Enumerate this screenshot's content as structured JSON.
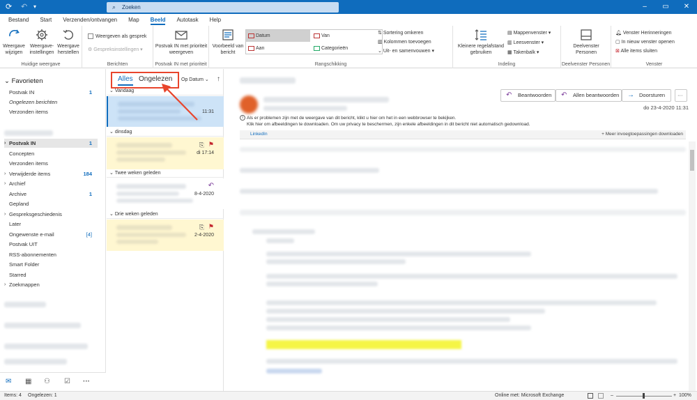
{
  "titlebar": {
    "search_placeholder": "Zoeken"
  },
  "menu": {
    "tabs": [
      "Bestand",
      "Start",
      "Verzenden/ontvangen",
      "Map",
      "Beeld",
      "Autotask",
      "Help"
    ],
    "active": "Beeld"
  },
  "ribbon": {
    "huidige_weergave": {
      "label": "Huidige weergave",
      "wijzigen": "Weergave wijzigen",
      "instellingen": "Weergave-instellingen",
      "herstellen": "Weergave herstellen"
    },
    "berichten": {
      "label": "Berichten",
      "als_gesprek": "Weergeven als gesprek",
      "gespreksinstellingen": "Gespreksinstellingen"
    },
    "prioriteit": {
      "label": "Postvak IN met prioriteit",
      "button": "Postvak IN met prioriteit weergeven"
    },
    "rangschikking": {
      "label": "Rangschikking",
      "voorbeeld": "Voorbeeld van bericht",
      "datum": "Datum",
      "van": "Van",
      "aan": "Aan",
      "categorieen": "Categorieën",
      "sortering": "Sortering omkeren",
      "kolommen": "Kolommen toevoegen",
      "uitvouwen": "Uit- en samenvouwen"
    },
    "indeling": {
      "label": "Indeling",
      "regelafstand": "Kleinere regelafstand gebruiken",
      "mappenvenster": "Mappenvenster",
      "leesvenster": "Leesvenster",
      "takenbalk": "Takenbalk"
    },
    "personen": {
      "label": "Deelvenster Personen",
      "button": "Deelvenster Personen"
    },
    "venster": {
      "label": "Venster",
      "herinneringen": "Venster Herinneringen",
      "nieuw_venster": "In nieuw venster openen",
      "sluiten": "Alle items sluiten"
    }
  },
  "nav": {
    "favorieten": "Favorieten",
    "favorites": [
      {
        "label": "Postvak IN",
        "count": "1"
      },
      {
        "label": "Ongelezen berichten",
        "count": ""
      },
      {
        "label": "Verzonden items",
        "count": ""
      }
    ],
    "folders": [
      {
        "label": "Postvak IN",
        "count": "1",
        "chev": "›",
        "selected": true
      },
      {
        "label": "Concepten",
        "count": "",
        "chev": ""
      },
      {
        "label": "Verzonden items",
        "count": "",
        "chev": ""
      },
      {
        "label": "Verwijderde items",
        "count": "184",
        "chev": "›"
      },
      {
        "label": "Archief",
        "count": "",
        "chev": "›"
      },
      {
        "label": "Archive",
        "count": "1",
        "chev": ""
      },
      {
        "label": "Gepland",
        "count": "",
        "chev": ""
      },
      {
        "label": "Gespreksgeschiedenis",
        "count": "",
        "chev": "›"
      },
      {
        "label": "Later",
        "count": "",
        "chev": ""
      },
      {
        "label": "Ongewenste e-mail",
        "count": "[4]",
        "chev": ""
      },
      {
        "label": "Postvak UIT",
        "count": "",
        "chev": ""
      },
      {
        "label": "RSS-abonnementen",
        "count": "",
        "chev": ""
      },
      {
        "label": "Smart Folder",
        "count": "",
        "chev": ""
      },
      {
        "label": "Starred",
        "count": "",
        "chev": ""
      },
      {
        "label": "Zoekmappen",
        "count": "",
        "chev": "›"
      }
    ]
  },
  "list": {
    "filter_all": "Alles",
    "filter_unread": "Ongelezen",
    "sort": "Op Datum",
    "groups": [
      "Vandaag",
      "dinsdag",
      "Twee weken geleden",
      "Drie weken geleden"
    ],
    "messages": [
      {
        "time": "11:31",
        "flag": false,
        "attach": false,
        "reply": false
      },
      {
        "time": "di 17:14",
        "flag": true,
        "attach": true,
        "reply": false
      },
      {
        "time": "8-4-2020",
        "flag": false,
        "attach": false,
        "reply": true
      },
      {
        "time": "2-4-2020",
        "flag": true,
        "attach": true,
        "reply": false
      }
    ]
  },
  "reading": {
    "reply": "Beantwoorden",
    "reply_all": "Allen beantwoorden",
    "forward": "Doorsturen",
    "more": "···",
    "date": "do 23-4-2020 11:31",
    "info_line1": "Als er problemen zijn met de weergave van dit bericht, klikt u hier om het in een webbrowser te bekijken.",
    "info_line2": "Klik hier om afbeeldingen te downloaden. Om uw privacy te beschermen, zijn enkele afbeeldingen in dit bericht niet automatisch gedownload.",
    "addin_linkedin": "LinkedIn",
    "addin_more": "+  Meer invoegtoepassingen downloaden"
  },
  "status": {
    "items": "Items: 4",
    "unread": "Ongelezen: 1",
    "connection": "Online met: Microsoft Exchange",
    "zoom": "100%"
  },
  "colors": {
    "accent": "#0f6cbd",
    "highlight_box": "#e8452c",
    "selected_row": "#cde3f7",
    "flagged_row": "#fff7d1",
    "flag": "#c4262e"
  }
}
